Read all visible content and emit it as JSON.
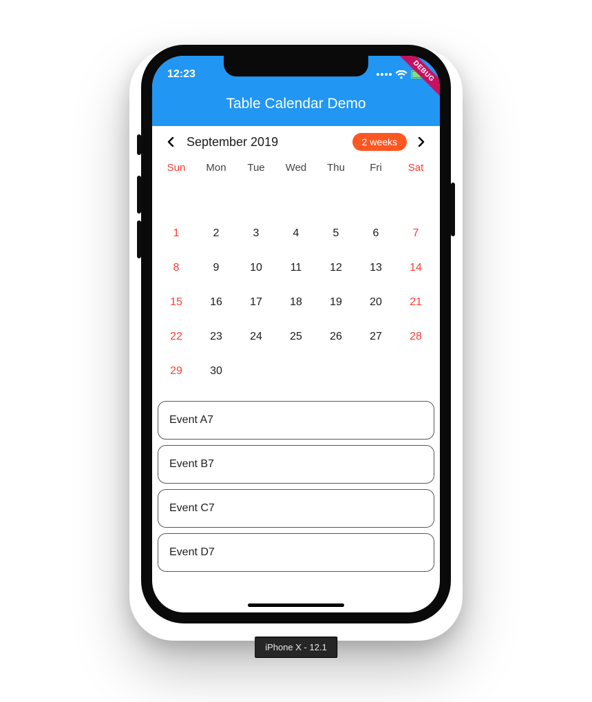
{
  "status": {
    "time": "12:23"
  },
  "debug_banner": "DEBUG",
  "appbar": {
    "title": "Table Calendar Demo"
  },
  "calendar": {
    "month_label": "September 2019",
    "format_label": "2 weeks",
    "dow": [
      "Sun",
      "Mon",
      "Tue",
      "Wed",
      "Thu",
      "Fri",
      "Sat"
    ],
    "weeks": [
      [
        {
          "d": "",
          "wknd": true
        },
        {
          "d": ""
        },
        {
          "d": ""
        },
        {
          "d": ""
        },
        {
          "d": ""
        },
        {
          "d": ""
        },
        {
          "d": "",
          "wknd": true
        }
      ],
      [
        {
          "d": "1",
          "wknd": true
        },
        {
          "d": "2"
        },
        {
          "d": "3"
        },
        {
          "d": "4"
        },
        {
          "d": "5"
        },
        {
          "d": "6"
        },
        {
          "d": "7",
          "wknd": true
        }
      ],
      [
        {
          "d": "8",
          "wknd": true
        },
        {
          "d": "9"
        },
        {
          "d": "10"
        },
        {
          "d": "11"
        },
        {
          "d": "12"
        },
        {
          "d": "13"
        },
        {
          "d": "14",
          "wknd": true
        }
      ],
      [
        {
          "d": "15",
          "wknd": true
        },
        {
          "d": "16"
        },
        {
          "d": "17"
        },
        {
          "d": "18"
        },
        {
          "d": "19"
        },
        {
          "d": "20"
        },
        {
          "d": "21",
          "wknd": true
        }
      ],
      [
        {
          "d": "22",
          "wknd": true
        },
        {
          "d": "23"
        },
        {
          "d": "24"
        },
        {
          "d": "25"
        },
        {
          "d": "26"
        },
        {
          "d": "27"
        },
        {
          "d": "28",
          "wknd": true
        }
      ],
      [
        {
          "d": "29",
          "wknd": true
        },
        {
          "d": "30"
        },
        {
          "d": ""
        },
        {
          "d": ""
        },
        {
          "d": ""
        },
        {
          "d": ""
        },
        {
          "d": "",
          "wknd": true
        }
      ]
    ]
  },
  "events": [
    "Event A7",
    "Event B7",
    "Event C7",
    "Event D7"
  ],
  "device_label": "iPhone X - 12.1"
}
